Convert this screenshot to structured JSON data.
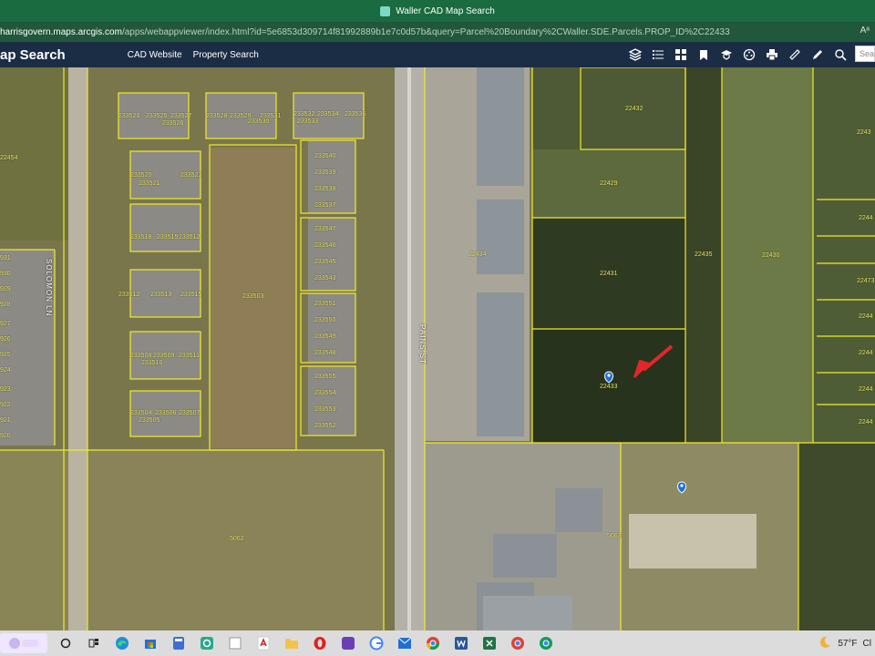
{
  "browser": {
    "title": "Waller CAD Map Search",
    "url_host": "harrisgovern.maps.arcgis.com",
    "url_path": "/apps/webappviewer/index.html?id=5e6853d309714f81992889b1e7c0d57b&query=Parcel%20Boundary%2CWaller.SDE.Parcels.PROP_ID%2C22433",
    "read_aloud": "Aᵃ"
  },
  "app": {
    "title": "ap Search",
    "links": [
      "CAD Website",
      "Property Search"
    ],
    "search_placeholder": "Sea",
    "tools": [
      "layers-icon",
      "list-icon",
      "basemap-gallery-icon",
      "bookmark-icon",
      "education-icon",
      "film-icon",
      "print-icon",
      "measure-icon",
      "draw-icon",
      "zoom-search-icon"
    ]
  },
  "map": {
    "streets": [
      "SOLOMON LN",
      "PAINS ST"
    ],
    "parcels": [
      {
        "label": "233520"
      },
      {
        "label": "233525"
      },
      {
        "label": "233527"
      },
      {
        "label": "233526"
      },
      {
        "label": "233528"
      },
      {
        "label": "233529"
      },
      {
        "label": "233530"
      },
      {
        "label": "233531"
      },
      {
        "label": "233532"
      },
      {
        "label": "233533"
      },
      {
        "label": "233534"
      },
      {
        "label": "233536"
      },
      {
        "label": "233540"
      },
      {
        "label": "233539"
      },
      {
        "label": "233538"
      },
      {
        "label": "233537"
      },
      {
        "label": "233547"
      },
      {
        "label": "233546"
      },
      {
        "label": "233545"
      },
      {
        "label": "233543"
      },
      {
        "label": "233551"
      },
      {
        "label": "233550"
      },
      {
        "label": "233549"
      },
      {
        "label": "233548"
      },
      {
        "label": "233555"
      },
      {
        "label": "233554"
      },
      {
        "label": "233553"
      },
      {
        "label": "233552"
      },
      {
        "label": "233520"
      },
      {
        "label": "233521"
      },
      {
        "label": "233523"
      },
      {
        "label": "233518"
      },
      {
        "label": "233515"
      },
      {
        "label": "233512"
      },
      {
        "label": "233512"
      },
      {
        "label": "233513"
      },
      {
        "label": "233515"
      },
      {
        "label": "233508"
      },
      {
        "label": "233509"
      },
      {
        "label": "233511"
      },
      {
        "label": "233510"
      },
      {
        "label": "233504"
      },
      {
        "label": "233506"
      },
      {
        "label": "233507"
      },
      {
        "label": "233505"
      },
      {
        "label": "233503"
      },
      {
        "label": "5062"
      },
      {
        "label": "5063"
      },
      {
        "label": "22432"
      },
      {
        "label": "22429"
      },
      {
        "label": "22431"
      },
      {
        "label": "22433"
      },
      {
        "label": "22434"
      },
      {
        "label": "22435"
      },
      {
        "label": "22430"
      },
      {
        "label": "22454"
      },
      {
        "label": "2243"
      },
      {
        "label": "2244"
      },
      {
        "label": "22473"
      },
      {
        "label": "2244"
      },
      {
        "label": "2244"
      },
      {
        "label": "2244"
      },
      {
        "label": "2244"
      },
      {
        "label": "931"
      },
      {
        "label": "930"
      },
      {
        "label": "929"
      },
      {
        "label": "928"
      },
      {
        "label": "927"
      },
      {
        "label": "926"
      },
      {
        "label": "925"
      },
      {
        "label": "924"
      },
      {
        "label": "923"
      },
      {
        "label": "922"
      },
      {
        "label": "921"
      },
      {
        "label": "920"
      }
    ]
  },
  "taskbar": {
    "weather": "57°F",
    "weather_desc": "Cl"
  },
  "colors": {
    "parcel_line": "#f2ea2a",
    "header_bg": "#1b2d45",
    "titlebar_bg": "#1a6b3f",
    "arrow": "#e3262b",
    "pin": "#1e6fd9"
  }
}
